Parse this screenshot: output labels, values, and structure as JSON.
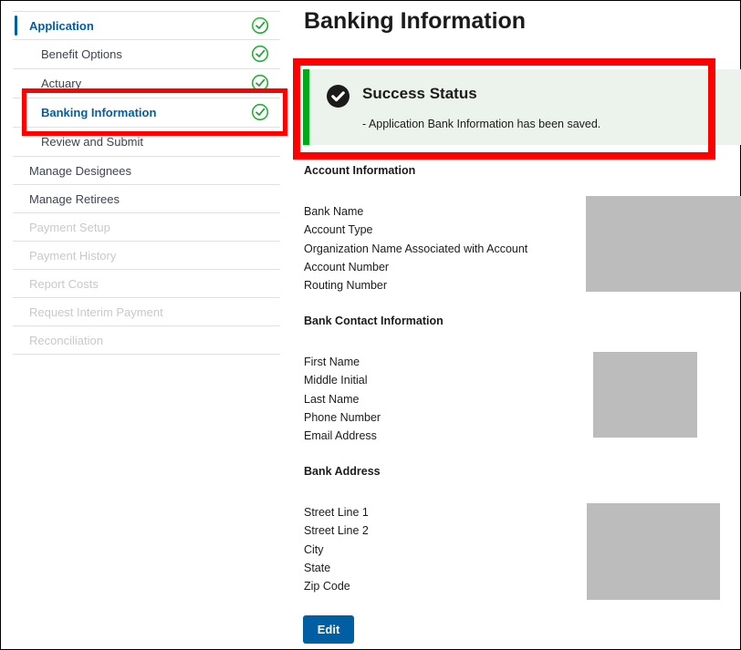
{
  "sidebar": {
    "items": [
      {
        "label": "Application",
        "state": "active-parent",
        "completed": true
      },
      {
        "label": "Benefit Options",
        "state": "sub",
        "completed": true
      },
      {
        "label": "Actuary",
        "state": "sub",
        "completed": true
      },
      {
        "label": "Banking Information",
        "state": "current",
        "completed": true
      },
      {
        "label": "Review and Submit",
        "state": "sub",
        "completed": false
      },
      {
        "label": "Manage Designees",
        "state": "top",
        "completed": false
      },
      {
        "label": "Manage Retirees",
        "state": "top",
        "completed": false
      },
      {
        "label": "Payment Setup",
        "state": "disabled",
        "completed": false
      },
      {
        "label": "Payment History",
        "state": "disabled",
        "completed": false
      },
      {
        "label": "Report Costs",
        "state": "disabled",
        "completed": false
      },
      {
        "label": "Request Interim Payment",
        "state": "disabled",
        "completed": false
      },
      {
        "label": "Reconciliation",
        "state": "disabled",
        "completed": false
      }
    ]
  },
  "page": {
    "title": "Banking Information"
  },
  "alert": {
    "title": "Success Status",
    "message": "-  Application Bank Information has been saved.",
    "icon": "check-circle-icon",
    "accent_color": "#00a91c",
    "background": "#ecf3ec"
  },
  "sections": [
    {
      "title": "Account Information",
      "fields": [
        "Bank Name",
        "Account Type",
        "Organization Name Associated with Account",
        "Account Number",
        "Routing Number"
      ]
    },
    {
      "title": "Bank Contact Information",
      "fields": [
        "First Name",
        "Middle Initial",
        "Last Name",
        "Phone Number",
        "Email Address"
      ]
    },
    {
      "title": "Bank Address",
      "fields": [
        "Street Line 1",
        "Street Line 2",
        "City",
        "State",
        "Zip Code"
      ]
    }
  ],
  "buttons": {
    "edit_label": "Edit"
  },
  "colors": {
    "primary": "#005ea2",
    "success": "#00a91c",
    "annotation": "#ff0000",
    "redaction": "#bcbcbc"
  }
}
